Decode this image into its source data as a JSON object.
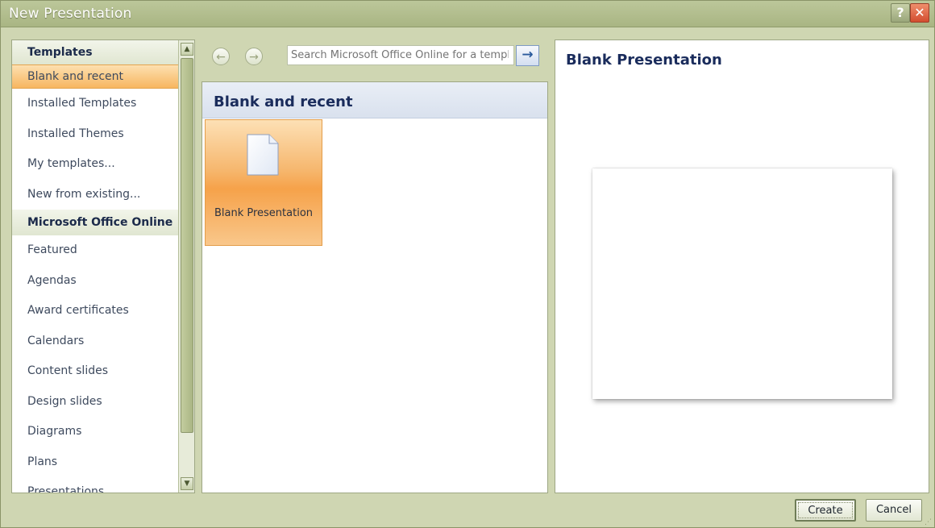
{
  "window": {
    "title": "New Presentation",
    "help_label": "?",
    "close_label": "✕"
  },
  "left": {
    "templates_header": "Templates",
    "templates_items": [
      "Blank and recent",
      "Installed Templates",
      "Installed Themes",
      "My templates...",
      "New from existing..."
    ],
    "online_header": "Microsoft Office Online",
    "online_items": [
      "Featured",
      "Agendas",
      "Award certificates",
      "Calendars",
      "Content slides",
      "Design slides",
      "Diagrams",
      "Plans",
      "Presentations"
    ],
    "selected": "Blank and recent"
  },
  "search": {
    "placeholder": "Search Microsoft Office Online for a template",
    "go_label": "→",
    "back_label": "←",
    "forward_label": "→"
  },
  "middle": {
    "header": "Blank and recent",
    "tiles": [
      {
        "label": "Blank Presentation"
      }
    ]
  },
  "right": {
    "title": "Blank Presentation"
  },
  "footer": {
    "create_label": "Create",
    "cancel_label": "Cancel"
  }
}
